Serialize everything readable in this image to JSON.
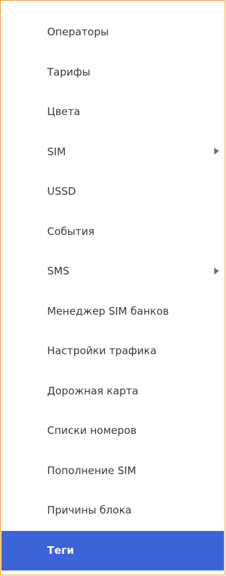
{
  "menu": {
    "items": [
      {
        "label": "Операторы",
        "has_submenu": false,
        "active": false
      },
      {
        "label": "Тарифы",
        "has_submenu": false,
        "active": false
      },
      {
        "label": "Цвета",
        "has_submenu": false,
        "active": false
      },
      {
        "label": "SIM",
        "has_submenu": true,
        "active": false
      },
      {
        "label": "USSD",
        "has_submenu": false,
        "active": false
      },
      {
        "label": "События",
        "has_submenu": false,
        "active": false
      },
      {
        "label": "SMS",
        "has_submenu": true,
        "active": false
      },
      {
        "label": "Менеджер SIM банков",
        "has_submenu": false,
        "active": false
      },
      {
        "label": "Настройки трафика",
        "has_submenu": false,
        "active": false
      },
      {
        "label": "Дорожная карта",
        "has_submenu": false,
        "active": false
      },
      {
        "label": "Списки номеров",
        "has_submenu": false,
        "active": false
      },
      {
        "label": "Пополнение SIM",
        "has_submenu": false,
        "active": false
      },
      {
        "label": "Причины блока",
        "has_submenu": false,
        "active": false
      },
      {
        "label": "Теги",
        "has_submenu": false,
        "active": true
      }
    ],
    "colors": {
      "border": "#e8a33a",
      "highlight": "#3d63d9",
      "text": "#3a3a3a",
      "highlight_text": "#ffffff"
    },
    "submenu_icon": "triangle-right-icon"
  }
}
